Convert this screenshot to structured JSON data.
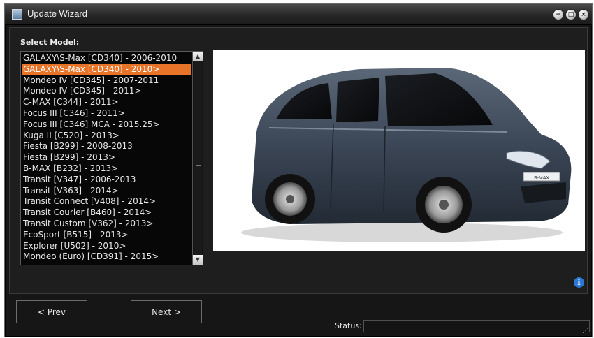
{
  "window": {
    "title": "Update Wizard",
    "controls": {
      "minimize": "−",
      "maximize": "□",
      "close": "×"
    }
  },
  "panel": {
    "label": "Select Model:"
  },
  "models": [
    "GALAXY\\S-Max [CD340] - 2006-2010",
    "GALAXY\\S-Max [CD340] - 2010>",
    "Mondeo IV [CD345] - 2007-2011",
    "Mondeo IV [CD345] - 2011>",
    "C-MAX [C344] - 2011>",
    "Focus III [C346] - 2011>",
    "Focus III [C346] MCA - 2015.25>",
    "Kuga II [C520] - 2013>",
    "Fiesta [B299] - 2008-2013",
    "Fiesta [B299] - 2013>",
    "B-MAX [B232] - 2013>",
    "Transit [V347] - 2006-2013",
    "Transit [V363] - 2014>",
    "Transit Connect [V408] - 2014>",
    "Transit Courier [B460] - 2014>",
    "Transit Custom [V362] - 2013>",
    "EcoSport [B515] - 2013>",
    "Explorer [U502] - 2010>",
    "Mondeo (Euro) [CD391] - 2015>"
  ],
  "selected_index": 1,
  "preview": {
    "plate": "S-MAX"
  },
  "icons": {
    "info": "i",
    "scroll_up": "▲",
    "scroll_down": "▼",
    "resize_grip": "⋰"
  },
  "footer": {
    "prev_label": "< Prev",
    "next_label": "Next >",
    "status_label": "Status:",
    "status_value": ""
  },
  "colors": {
    "selection": "#e8742a",
    "window_bg": "#161616",
    "info_blue": "#2b79d4"
  }
}
